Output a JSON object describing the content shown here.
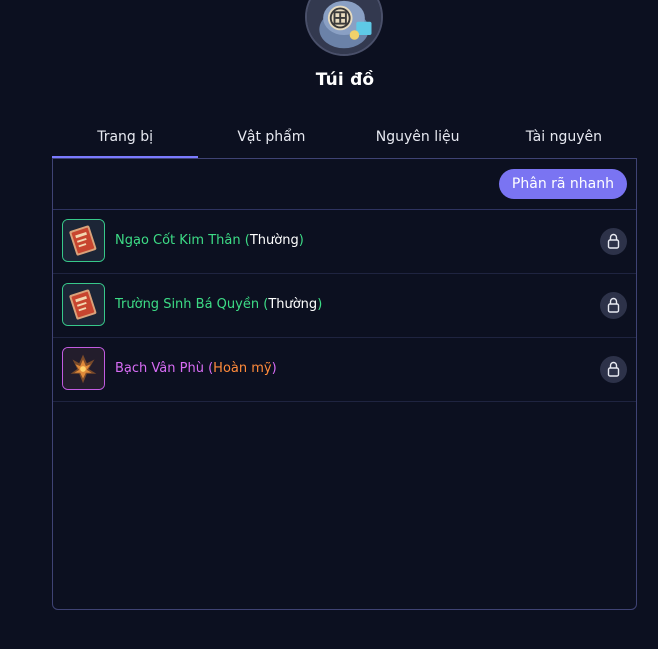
{
  "header": {
    "title": "Túi đồ",
    "avatar_icon": "bag-icon"
  },
  "tabs": [
    {
      "label": "Trang bị",
      "active": true
    },
    {
      "label": "Vật phẩm",
      "active": false
    },
    {
      "label": "Nguyên liệu",
      "active": false
    },
    {
      "label": "Tài nguyên",
      "active": false
    }
  ],
  "toolbar": {
    "quick_decompose_label": "Phân rã nhanh"
  },
  "items": [
    {
      "name": "Ngạo Cốt Kim Thân",
      "open": " (",
      "rarity": "Thường",
      "close": ")",
      "rarity_color": "#3ddc86",
      "icon": "red-book-icon",
      "locked_icon": "lock-icon"
    },
    {
      "name": "Trường Sinh Bá Quyền",
      "open": " (",
      "rarity": "Thường",
      "close": ")",
      "rarity_color": "#3ddc86",
      "icon": "red-book-icon",
      "locked_icon": "lock-icon"
    },
    {
      "name": "Bạch Vân Phù",
      "open": " (",
      "rarity": "Hoàn mỹ",
      "close": ")",
      "rarity_color": "#d86cf5",
      "icon": "talisman-icon",
      "locked_icon": "lock-icon"
    }
  ],
  "colors": {
    "accent": "#7a74f2",
    "common": "#3ddc86",
    "perfect": "#d86cf5",
    "perfect_label": "#ff8a3a",
    "background": "#0c1020"
  }
}
